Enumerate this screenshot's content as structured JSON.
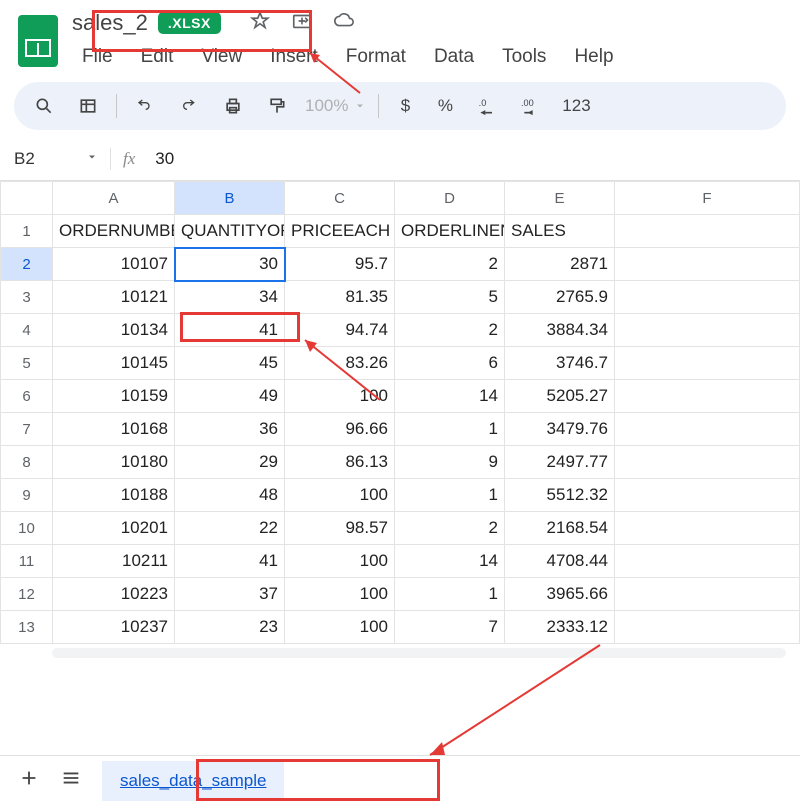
{
  "doc": {
    "name": "sales_2",
    "badge": ".XLSX"
  },
  "menu": [
    "File",
    "Edit",
    "View",
    "Insert",
    "Format",
    "Data",
    "Tools",
    "Help"
  ],
  "toolbar": {
    "zoom": "100%",
    "currency": "$",
    "percent": "%",
    "dec_dec": ".0",
    "dec_inc": ".00",
    "num_fmt": "123"
  },
  "fx": {
    "ref": "B2",
    "value": "30"
  },
  "columns": [
    "A",
    "B",
    "C",
    "D",
    "E",
    "F"
  ],
  "headers_row": [
    "ORDERNUMBER",
    "QUANTITYORDERED",
    "PRICEEACH",
    "ORDERLINENUMBER",
    "SALES",
    ""
  ],
  "rows": [
    {
      "n": "2",
      "c": [
        "10107",
        "30",
        "95.7",
        "2",
        "2871",
        ""
      ]
    },
    {
      "n": "3",
      "c": [
        "10121",
        "34",
        "81.35",
        "5",
        "2765.9",
        ""
      ]
    },
    {
      "n": "4",
      "c": [
        "10134",
        "41",
        "94.74",
        "2",
        "3884.34",
        ""
      ]
    },
    {
      "n": "5",
      "c": [
        "10145",
        "45",
        "83.26",
        "6",
        "3746.7",
        ""
      ]
    },
    {
      "n": "6",
      "c": [
        "10159",
        "49",
        "100",
        "14",
        "5205.27",
        ""
      ]
    },
    {
      "n": "7",
      "c": [
        "10168",
        "36",
        "96.66",
        "1",
        "3479.76",
        ""
      ]
    },
    {
      "n": "8",
      "c": [
        "10180",
        "29",
        "86.13",
        "9",
        "2497.77",
        ""
      ]
    },
    {
      "n": "9",
      "c": [
        "10188",
        "48",
        "100",
        "1",
        "5512.32",
        ""
      ]
    },
    {
      "n": "10",
      "c": [
        "10201",
        "22",
        "98.57",
        "2",
        "2168.54",
        ""
      ]
    },
    {
      "n": "11",
      "c": [
        "10211",
        "41",
        "100",
        "14",
        "4708.44",
        ""
      ]
    },
    {
      "n": "12",
      "c": [
        "10223",
        "37",
        "100",
        "1",
        "3965.66",
        ""
      ]
    },
    {
      "n": "13",
      "c": [
        "10237",
        "23",
        "100",
        "7",
        "2333.12",
        ""
      ]
    }
  ],
  "sheet_tab": "sales_data_sample"
}
